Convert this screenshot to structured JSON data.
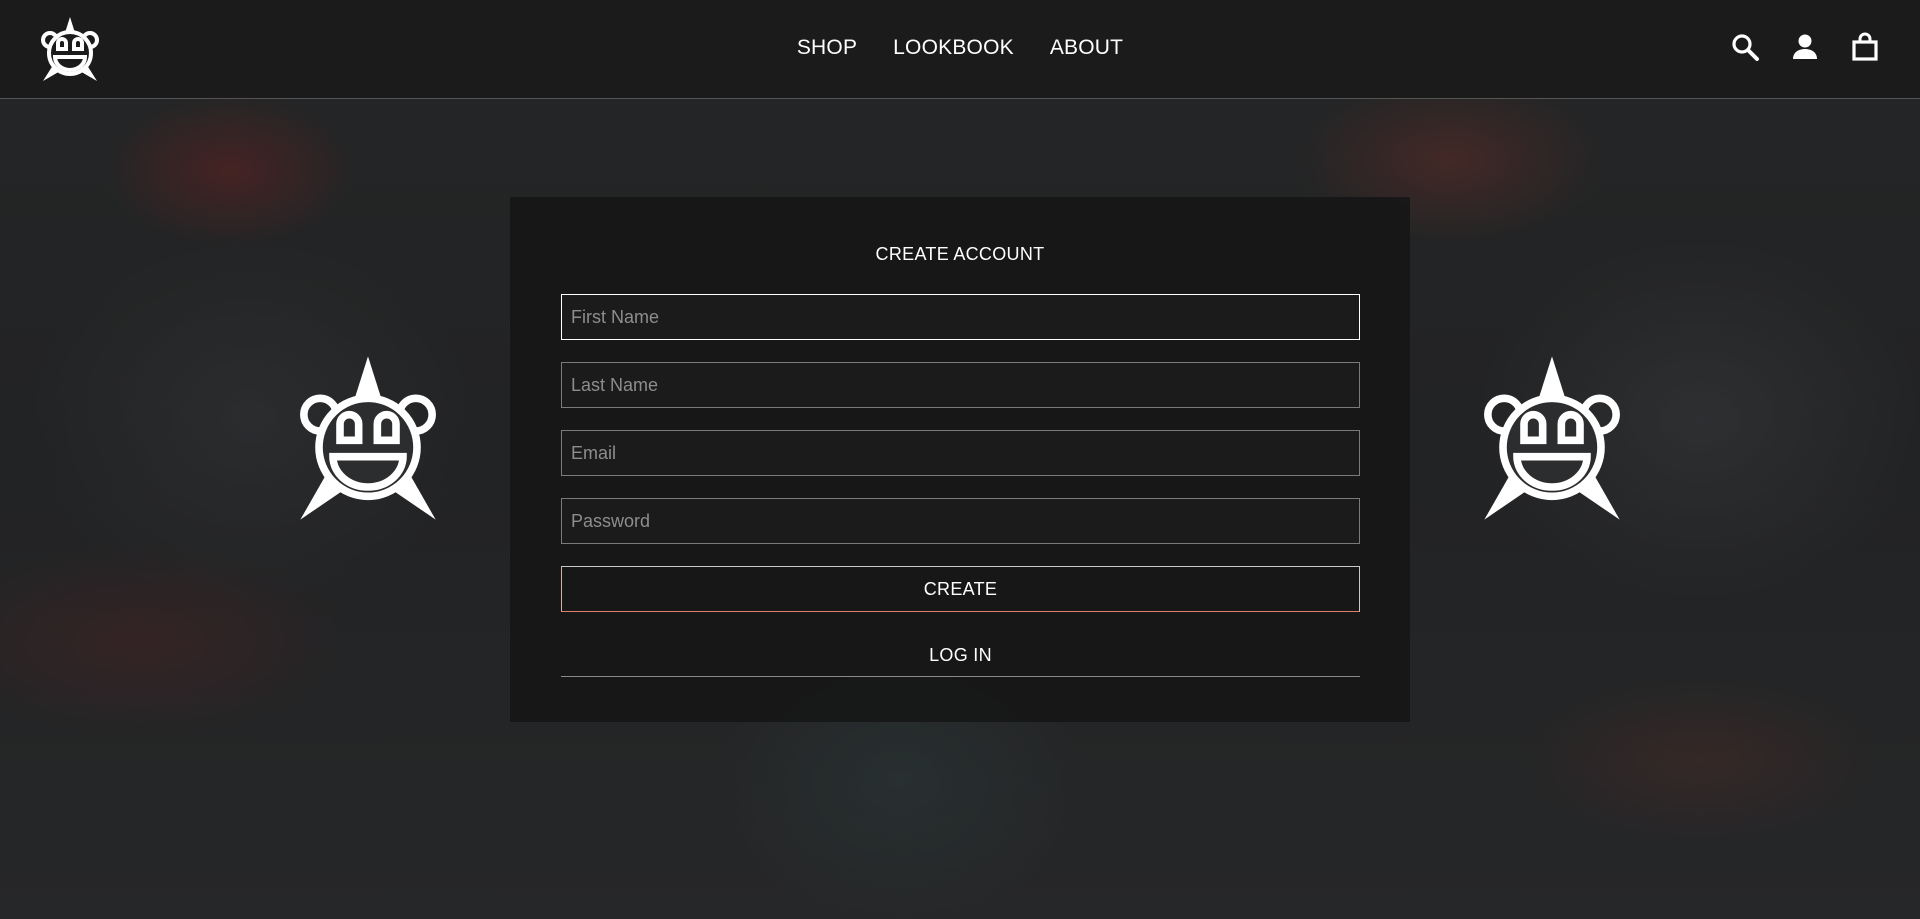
{
  "header": {
    "nav": [
      {
        "label": "SHOP"
      },
      {
        "label": "LOOKBOOK"
      },
      {
        "label": "ABOUT"
      }
    ],
    "icons": [
      "search-icon",
      "account-icon",
      "cart-icon"
    ]
  },
  "form": {
    "title": "CREATE ACCOUNT",
    "first_name": {
      "value": "",
      "placeholder": "First Name"
    },
    "last_name": {
      "value": "",
      "placeholder": "Last Name"
    },
    "email": {
      "value": "",
      "placeholder": "Email"
    },
    "password": {
      "value": "",
      "placeholder": "Password"
    },
    "create_label": "CREATE",
    "login_label": "LOG IN"
  },
  "colors": {
    "header_bg": "#1b1b1b",
    "card_bg": "#161616",
    "text": "#ffffff",
    "placeholder": "#8d8d8d",
    "button_accent": "#e0806c"
  }
}
